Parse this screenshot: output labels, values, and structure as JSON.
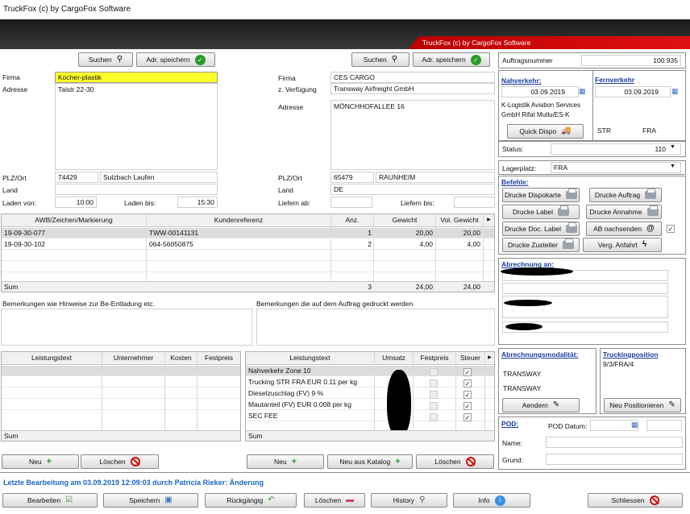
{
  "window": {
    "title": "TruckFox (c) by CargoFox Software",
    "banner": "TruckFox (c) by CargoFox Software"
  },
  "shipper": {
    "search_label": "Suchen",
    "save_label": "Adr. speichern",
    "firma_label": "Firma",
    "firma": "Kocher-plastik",
    "adresse_label": "Adresse",
    "adresse": "Talstr 22-30",
    "plz_label": "PLZ/Ort",
    "plz": "74429",
    "ort": "Sulzbach Laufen",
    "land_label": "Land",
    "land": "",
    "laden_von_label": "Laden von:",
    "laden_von": "10:00",
    "laden_bis_label": "Laden bis:",
    "laden_bis": "15:30"
  },
  "consignee": {
    "search_label": "Suchen",
    "save_label": "Adr. speichern",
    "firma_label": "Firma",
    "firma": "CES CARGO",
    "zverf_label": "z. Verfügung",
    "zverf": "Transway Airfreight GmbH",
    "adresse_label": "Adresse",
    "adresse": "MÖNCHHOFALLEE 16",
    "plz_label": "PLZ/Ort",
    "plz": "65479",
    "ort": "RAUNHEIM",
    "land_label": "Land",
    "land": "DE",
    "liefern_ab_label": "Liefern ab:",
    "liefern_ab": "",
    "liefern_bis_label": "Liefern bis:",
    "liefern_bis": ""
  },
  "order": {
    "auftragsnummer_label": "Auftragsnummer",
    "auftragsnummer": "100.935",
    "nahverkehr_label": "Nahverkehr:",
    "nahverkehr_date": "03.09.2019",
    "nahverkehr_company": "K-Logistik Aviation Services GmbH Rifat Mutlu/ES-K",
    "quick_dispo_label": "Quick Dispo",
    "fernverkehr_label": "Fernverkehr",
    "fernverkehr_date": "03.09.2019",
    "from": "STR",
    "to": "FRA",
    "status_label": "Status:",
    "status": "110",
    "lagerplatz_label": "Lagerplatz:",
    "lagerplatz": "FRA"
  },
  "befehle": {
    "title": "Befehle:",
    "buttons": [
      "Drucke Dispokarte",
      "Drucke Auftrag",
      "Drucke Label",
      "Drucke Annahme",
      "Drucke Doc. Label",
      "AB nachsenden",
      "Drucke Zusteller",
      "Verg. Anfahrt"
    ]
  },
  "abrechnung": {
    "title": "Abrechnung an:"
  },
  "modalitaet": {
    "title": "Abrechnungsmodalität:",
    "line1": "TRANSWAY",
    "line2": "TRANSWAY",
    "button": "Aendern"
  },
  "trucking": {
    "title": "Truckingposition",
    "value": "9/3/FRA/4",
    "button": "Neu Positionieren"
  },
  "pod": {
    "title": "POD:",
    "datum_label": "POD Datum:",
    "name_label": "Name:",
    "grund_label": "Grund:"
  },
  "items": {
    "headers": [
      "AWB/Zeichen/Markierung",
      "Kundenreferenz",
      "Anz.",
      "Gewicht",
      "Vol. Gewicht"
    ],
    "rows": [
      [
        "19-09-30-077",
        "TWW-00141131",
        "1",
        "20,00",
        "20,00"
      ],
      [
        "19-09-30-102",
        "064-56050875",
        "2",
        "4,00",
        "4,00"
      ]
    ],
    "sum_label": "Sum",
    "sum": [
      "3",
      "24,00",
      "24,00"
    ]
  },
  "remarks": {
    "left": "Bemerkungen wie Hinweise zur Be-Entladung etc.",
    "right": "Bemerkungen die auf dem Auftrag gedruckt werden"
  },
  "costs": {
    "headers": [
      "Leistungstext",
      "Unternehmer",
      "Kosten",
      "Festpreis"
    ],
    "sum_label": "Sum",
    "new": "Neu",
    "delete": "Löschen"
  },
  "revenue": {
    "headers": [
      "Leistungstext",
      "Umsatz",
      "Festpreis",
      "Steuer"
    ],
    "rows": [
      "Nahverkehr Zone 10",
      "Trucking STR FRA EUR 0.11 per kg",
      "Dieselzuschlag (FV) 9 %",
      "Mautanteil (FV) EUR 0.008 per kg",
      "SEC FEE"
    ],
    "sum_label": "Sum",
    "new": "Neu",
    "new_catalog": "Neu aus Katalog",
    "delete": "Löschen"
  },
  "footer": {
    "last_edit": "Letzte Bearbeitung am 03.09.2019 12:09:03 durch Patricia Rieker: Änderung",
    "buttons": [
      "Bearbeiten",
      "Speichern",
      "Rückgängig",
      "Löschen",
      "History",
      "Info",
      "Schliessen"
    ]
  }
}
